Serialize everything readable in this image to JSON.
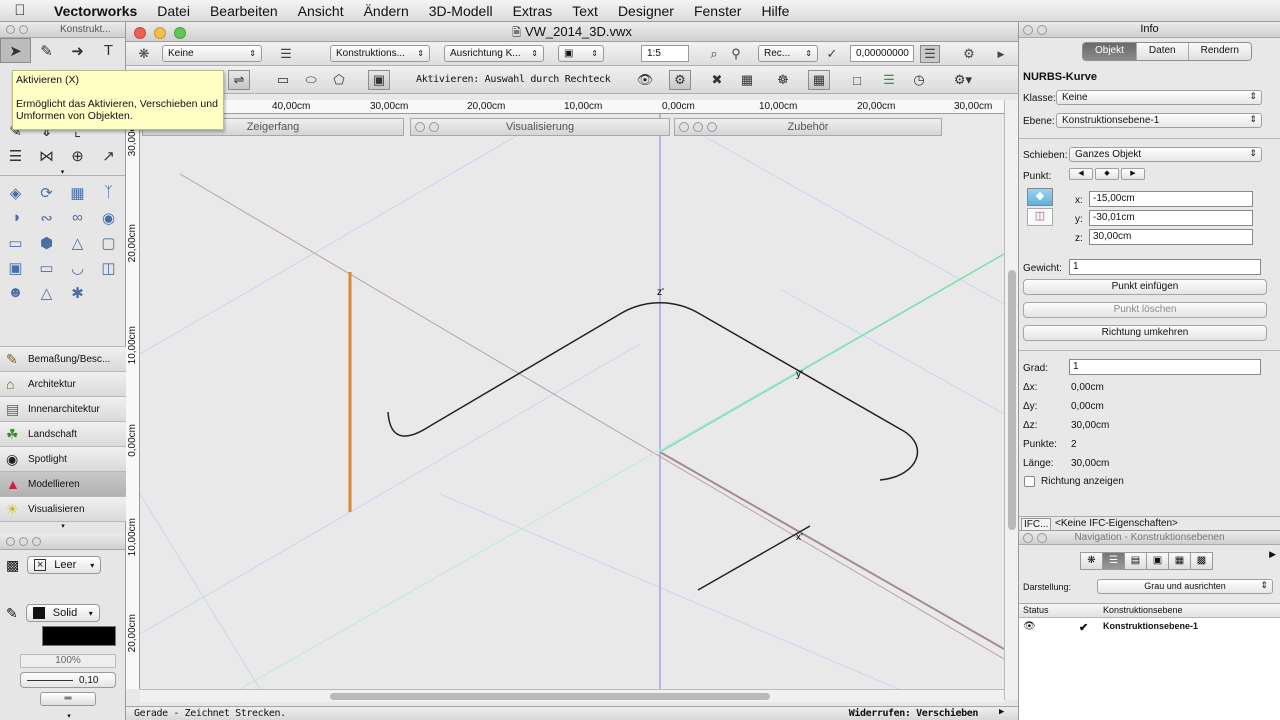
{
  "menubar": {
    "app": "Vectorworks",
    "items": [
      "Datei",
      "Bearbeiten",
      "Ansicht",
      "Ändern",
      "3D-Modell",
      "Extras",
      "Text",
      "Designer",
      "Fenster",
      "Hilfe"
    ]
  },
  "tool_palette": {
    "title": "Konstrukt...",
    "tooltip_title": "Aktivieren (X)",
    "tooltip_text": "Ermöglicht das Aktivieren, Verschieben und Umformen von Objekten.",
    "tool_sets": [
      "Bemaßung/Besc...",
      "Architektur",
      "Innenarchitektur",
      "Landschaft",
      "Spotlight",
      "Modellieren",
      "Visualisieren"
    ],
    "active_set": "Modellieren"
  },
  "attributes": {
    "fill_label": "Leer",
    "pen_label": "Solid",
    "opacity": "100%",
    "line_weight": "0,10"
  },
  "document": {
    "title": "VW_2014_3D.vwx",
    "view": {
      "class_popup": "Keine",
      "layer_popup": "Konstruktions...",
      "orientation_popup": "Ausrichtung K...",
      "scale": "1:5",
      "render_popup": "Rec...",
      "value_field": "0,00000000"
    },
    "mode_message": "Aktivieren: Auswahl durch Rechteck",
    "hruler_labels": [
      "40,00cm",
      "30,00cm",
      "20,00cm",
      "10,00cm",
      "0,00cm",
      "10,00cm",
      "20,00cm",
      "30,00cm"
    ],
    "vruler_labels": [
      "30,00cm",
      "20,00cm",
      "10,00cm",
      "0,00cm",
      "10,00cm",
      "20,00cm"
    ],
    "subpalettes": [
      "Zeigerfang",
      "Visualisierung",
      "Zubehör"
    ],
    "axis_labels": {
      "z": "z'",
      "y": "y'",
      "x": "x'"
    },
    "status_left": "Gerade - Zeichnet Strecken.",
    "status_right": "Widerrufen: Verschieben"
  },
  "info": {
    "title": "Info",
    "tabs": [
      "Objekt",
      "Daten",
      "Rendern"
    ],
    "active_tab": "Objekt",
    "object_type": "NURBS-Kurve",
    "klasse_label": "Klasse:",
    "klasse_value": "Keine",
    "ebene_label": "Ebene:",
    "ebene_value": "Konstruktionsebene-1",
    "schieben_label": "Schieben:",
    "schieben_value": "Ganzes Objekt",
    "punkt_label": "Punkt:",
    "x_label": "x:",
    "x_value": "-15,00cm",
    "y_label": "y:",
    "y_value": "-30,01cm",
    "z_label": "z:",
    "z_value": "30,00cm",
    "gewicht_label": "Gewicht:",
    "gewicht_value": "1",
    "btn_insert": "Punkt einfügen",
    "btn_delete": "Punkt löschen",
    "btn_reverse": "Richtung umkehren",
    "grad_label": "Grad:",
    "grad_value": "1",
    "dx_label": "Δx:",
    "dx_value": "0,00cm",
    "dy_label": "Δy:",
    "dy_value": "0,00cm",
    "dz_label": "Δz:",
    "dz_value": "30,00cm",
    "punkte_label": "Punkte:",
    "punkte_value": "2",
    "laenge_label": "Länge:",
    "laenge_value": "30,00cm",
    "show_direction": "Richtung anzeigen",
    "ifc_btn": "IFC...",
    "ifc_text": "<Keine IFC-Eigenschaften>"
  },
  "navigation": {
    "title": "Navigation - Konstruktionsebenen",
    "darstellung_label": "Darstellung:",
    "darstellung_value": "Grau und ausrichten",
    "col_status": "Status",
    "col_layer": "Konstruktionsebene",
    "row_name": "Konstruktionsebene-1"
  },
  "colors": {
    "accent": "#5b8fd6",
    "axis_z": "#9b8fe6",
    "axis_y": "#7fe0b5",
    "axis_x": "#a58a93",
    "highlight_orange": "#d18a3a"
  }
}
